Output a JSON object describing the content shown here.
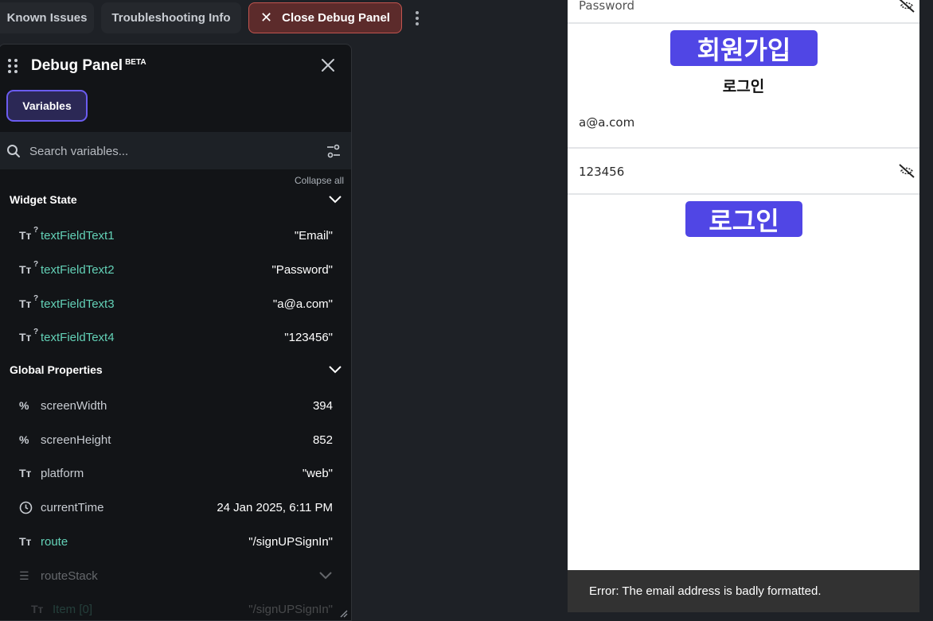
{
  "topbar": {
    "known_issues": "Known Issues",
    "troubleshooting": "Troubleshooting Info",
    "close_debug": "Close Debug Panel"
  },
  "panel": {
    "title": "Debug Panel",
    "beta": "BETA",
    "tab_variables": "Variables",
    "search_placeholder": "Search variables...",
    "collapse_all": "Collapse all",
    "widget_state": {
      "label": "Widget State",
      "rows": [
        {
          "name": "textFieldText1",
          "value": "\"Email\""
        },
        {
          "name": "textFieldText2",
          "value": "\"Password\""
        },
        {
          "name": "textFieldText3",
          "value": "\"a@a.com\""
        },
        {
          "name": "textFieldText4",
          "value": "\"123456\""
        }
      ]
    },
    "global": {
      "label": "Global Properties",
      "rows": [
        {
          "name": "screenWidth",
          "value": "394",
          "icon": "percent-icon"
        },
        {
          "name": "screenHeight",
          "value": "852",
          "icon": "percent-icon"
        },
        {
          "name": "platform",
          "value": "\"web\"",
          "icon": "text-type-icon"
        },
        {
          "name": "currentTime",
          "value": "24 Jan 2025, 6:11 PM",
          "icon": "clock-icon"
        },
        {
          "name": "route",
          "value": "\"/signUPSignIn\"",
          "icon": "text-type-icon"
        },
        {
          "name": "routeStack",
          "value": "",
          "icon": "list-icon"
        },
        {
          "name": "Item [0]",
          "value": "\"/signUPSignIn\"",
          "icon": "text-type-icon"
        }
      ]
    }
  },
  "phone": {
    "password_field": "Password",
    "signup_button": "회원가입",
    "login_title": "로그인",
    "email_value": "a@a.com",
    "password_value": "123456",
    "login_button": "로그인",
    "snackbar": "Error: The email address is badly formatted."
  },
  "colors": {
    "accent": "#5046e5",
    "teal": "#63d1b7",
    "close_bg": "#5c2b2b",
    "close_border": "#c2554f"
  }
}
